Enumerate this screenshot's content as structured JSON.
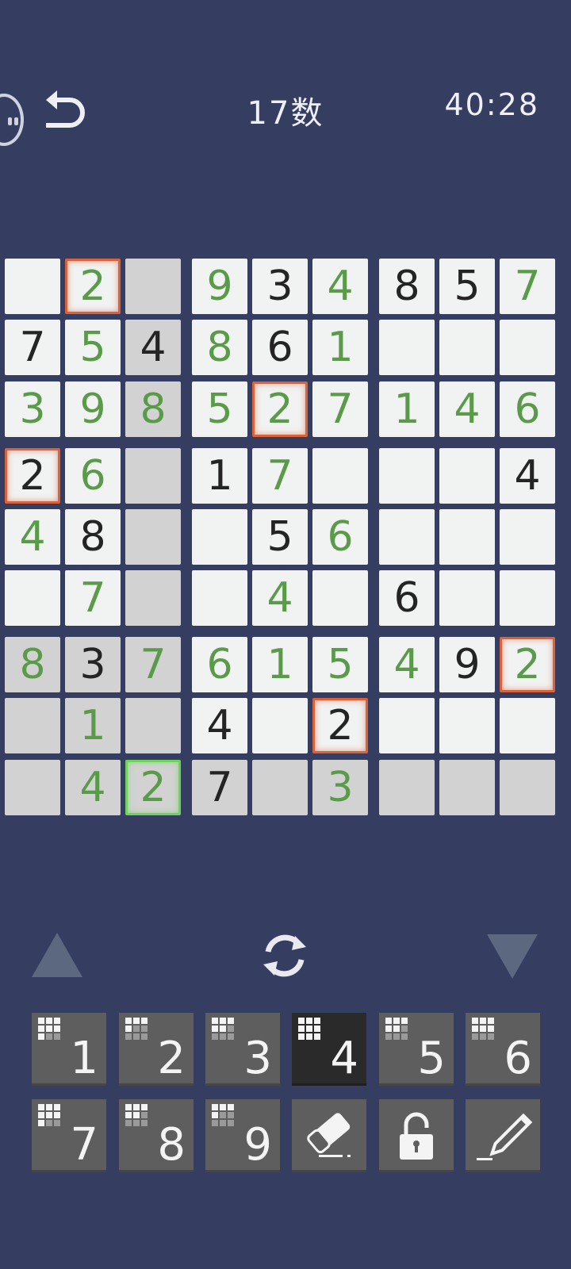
{
  "header": {
    "title": "17数",
    "timer": "40:28"
  },
  "colors": {
    "background": "#353d61",
    "given_digit": "#242424",
    "entered_digit": "#5a9b4a",
    "highlight_cell": "#d2d2d2",
    "conflict_border": "#d9623b",
    "selected_border": "#6ed35a",
    "key_bg": "#5e5e5e",
    "key_active_bg": "#2a2a2a"
  },
  "icons": {
    "undo": "undo-arrow-icon",
    "refresh": "refresh-cycle-icon",
    "up": "triangle-up-icon",
    "down": "triangle-down-icon",
    "eraser": "eraser-icon",
    "lock": "lock-icon",
    "pencil": "pencil-icon"
  },
  "board": {
    "rows": [
      [
        "",
        "2",
        "",
        "9",
        "3",
        "4",
        "8",
        "5",
        "7"
      ],
      [
        "7",
        "5",
        "4",
        "8",
        "6",
        "1",
        "",
        "",
        ""
      ],
      [
        "3",
        "9",
        "8",
        "5",
        "2",
        "7",
        "1",
        "4",
        "6"
      ],
      [
        "2",
        "6",
        "",
        "1",
        "7",
        "",
        "",
        "",
        "4"
      ],
      [
        "4",
        "8",
        "",
        "",
        "5",
        "6",
        "",
        "",
        ""
      ],
      [
        "",
        "7",
        "",
        "",
        "4",
        "",
        "6",
        "",
        ""
      ],
      [
        "8",
        "3",
        "7",
        "6",
        "1",
        "5",
        "4",
        "9",
        "2"
      ],
      [
        "",
        "1",
        "",
        "4",
        "",
        "2",
        "",
        "",
        ""
      ],
      [
        "",
        "4",
        "2",
        "7",
        "",
        "3",
        "",
        "",
        ""
      ]
    ],
    "entered": [
      [
        0,
        1,
        0,
        1,
        0,
        1,
        0,
        0,
        1
      ],
      [
        0,
        1,
        0,
        1,
        0,
        1,
        0,
        0,
        0
      ],
      [
        1,
        1,
        1,
        1,
        1,
        1,
        1,
        1,
        1
      ],
      [
        0,
        1,
        0,
        0,
        1,
        0,
        0,
        0,
        0
      ],
      [
        1,
        0,
        0,
        0,
        0,
        1,
        0,
        0,
        0
      ],
      [
        0,
        1,
        0,
        0,
        1,
        0,
        0,
        0,
        0
      ],
      [
        1,
        0,
        1,
        1,
        1,
        1,
        1,
        0,
        1
      ],
      [
        0,
        1,
        0,
        0,
        0,
        0,
        0,
        0,
        0
      ],
      [
        0,
        1,
        1,
        0,
        0,
        1,
        0,
        0,
        0
      ]
    ],
    "highlighted": [
      [
        0,
        0,
        1,
        0,
        0,
        0,
        0,
        0,
        0
      ],
      [
        0,
        0,
        1,
        0,
        0,
        0,
        0,
        0,
        0
      ],
      [
        0,
        0,
        1,
        0,
        0,
        0,
        0,
        0,
        0
      ],
      [
        0,
        0,
        1,
        0,
        0,
        0,
        0,
        0,
        0
      ],
      [
        0,
        0,
        1,
        0,
        0,
        0,
        0,
        0,
        0
      ],
      [
        0,
        0,
        1,
        0,
        0,
        0,
        0,
        0,
        0
      ],
      [
        1,
        1,
        1,
        0,
        0,
        0,
        0,
        0,
        0
      ],
      [
        1,
        1,
        1,
        0,
        0,
        0,
        0,
        0,
        0
      ],
      [
        1,
        1,
        1,
        1,
        1,
        1,
        1,
        1,
        1
      ]
    ],
    "conflicts": [
      [
        0,
        1
      ],
      [
        2,
        4
      ],
      [
        3,
        0
      ],
      [
        6,
        8
      ],
      [
        7,
        5
      ]
    ],
    "selected": [
      8,
      2
    ]
  },
  "keypad": {
    "keys": [
      {
        "label": "1",
        "remaining": [
          1,
          1,
          1,
          1,
          1,
          1,
          1,
          0,
          0
        ]
      },
      {
        "label": "2",
        "remaining": [
          1,
          1,
          1,
          1,
          0,
          0,
          0,
          0,
          0
        ]
      },
      {
        "label": "3",
        "remaining": [
          1,
          1,
          1,
          1,
          1,
          0,
          0,
          0,
          0
        ]
      },
      {
        "label": "4",
        "remaining": [
          1,
          1,
          1,
          1,
          1,
          1,
          1,
          1,
          1
        ]
      },
      {
        "label": "5",
        "remaining": [
          1,
          1,
          1,
          1,
          1,
          0,
          0,
          0,
          0
        ]
      },
      {
        "label": "6",
        "remaining": [
          1,
          1,
          1,
          1,
          1,
          1,
          0,
          0,
          0
        ]
      },
      {
        "label": "7",
        "remaining": [
          1,
          1,
          1,
          1,
          1,
          1,
          1,
          0,
          0
        ]
      },
      {
        "label": "8",
        "remaining": [
          1,
          1,
          1,
          1,
          1,
          0,
          0,
          0,
          0
        ]
      },
      {
        "label": "9",
        "remaining": [
          1,
          1,
          1,
          1,
          0,
          0,
          0,
          0,
          0
        ]
      }
    ],
    "active": "4"
  }
}
